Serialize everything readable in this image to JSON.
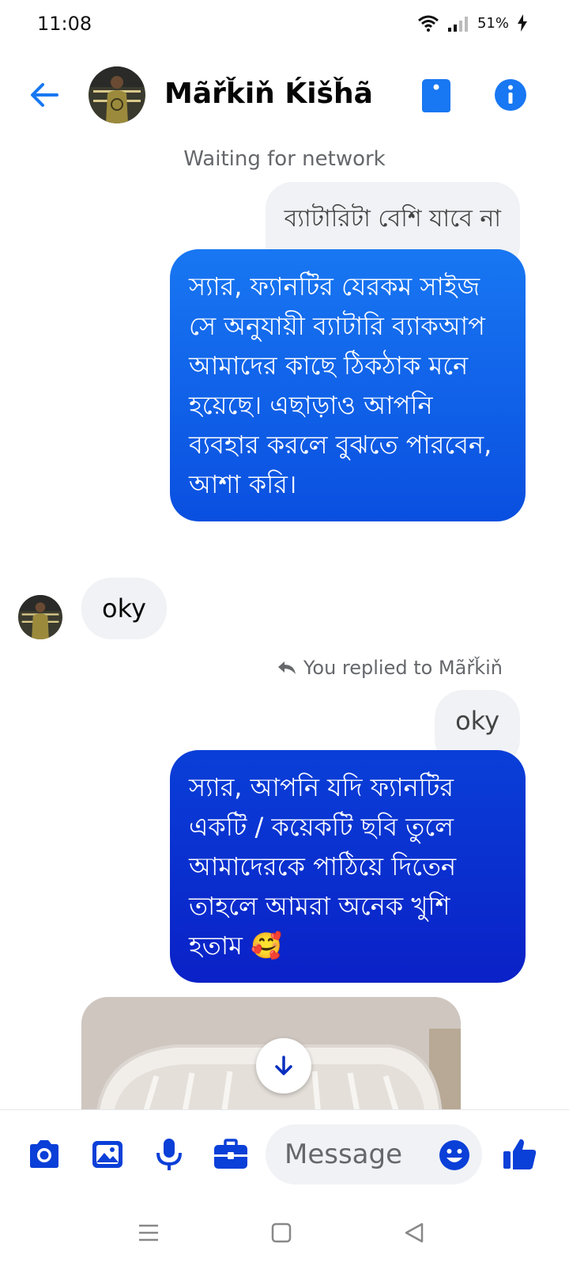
{
  "status_bar": {
    "time": "11:08",
    "battery": "51%"
  },
  "header": {
    "contact_name": "Mãřǩiň Ḱišȟã"
  },
  "network_status": "Waiting for network",
  "messages": {
    "out1": "ব্যাটারিটা বেশি যাবে না",
    "out2": "স্যার, ফ্যানটির যেরকম সাইজ সে অনুযায়ী ব্যাটারি ব্যাকআপ আমাদের কাছে ঠিকঠাক মনে হয়েছে। এছাড়াও আপনি ব্যবহার করলে বুঝতে পারবেন, আশা করি।",
    "in1": "oky",
    "reply_note": "You replied to Mãřǩiň",
    "quoted": "oky",
    "out3": "স্যার, আপনি যদি ফ্যানটির একটি / কয়েকটি ছবি তুলে আমাদেরকে পাঠিয়ে দিতেন তাহলে আমরা অনেক খুশি হতাম 🥰"
  },
  "composer": {
    "placeholder": "Message"
  },
  "colors": {
    "accent": "#1877f2",
    "bubble_blue": "#0a4fe0",
    "bubble_gray": "#f0f2f5"
  }
}
